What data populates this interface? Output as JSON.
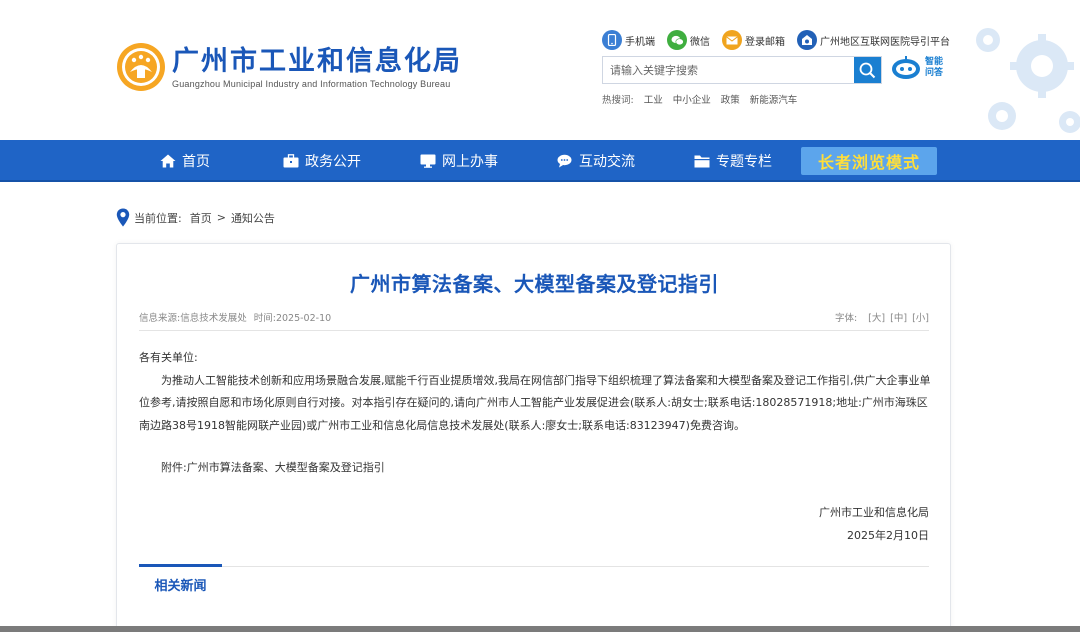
{
  "header": {
    "logo_cn": "广州市工业和信息化局",
    "logo_en": "Guangzhou Municipal Industry and Information Technology Bureau",
    "quick_links": [
      {
        "label": "手机端",
        "icon": "mobile-icon",
        "color": "#3b7fd4"
      },
      {
        "label": "微信",
        "icon": "wechat-icon",
        "color": "#3fae3f"
      },
      {
        "label": "登录邮箱",
        "icon": "mail-icon",
        "color": "#f0a41e"
      },
      {
        "label": "广州地区互联网医院导引平台",
        "icon": "hospital-icon",
        "color": "#2261b7"
      }
    ],
    "search_placeholder": "请输入关键字搜索",
    "robot_label_1": "智能",
    "robot_label_2": "问答",
    "hot_label": "热搜词:",
    "hot_words": [
      "工业",
      "中小企业",
      "政策",
      "新能源汽车"
    ]
  },
  "nav": {
    "items": [
      {
        "label": "首页",
        "icon": "home-icon"
      },
      {
        "label": "政务公开",
        "icon": "briefcase-icon"
      },
      {
        "label": "网上办事",
        "icon": "monitor-icon"
      },
      {
        "label": "互动交流",
        "icon": "chat-icon"
      },
      {
        "label": "专题专栏",
        "icon": "folder-icon"
      }
    ],
    "elder_mode": "长者浏览模式"
  },
  "breadcrumb": {
    "label": "当前位置:",
    "home": "首页",
    "separator": ">",
    "current": "通知公告"
  },
  "article": {
    "title": "广州市算法备案、大模型备案及登记指引",
    "source_label": "信息来源:",
    "source": "信息技术发展处",
    "time_label": "时间:",
    "time": "2025-02-10",
    "font_label": "字体:",
    "font_large": "[大]",
    "font_medium": "[中]",
    "font_small": "[小]",
    "salutation": "各有关单位:",
    "body": "为推动人工智能技术创新和应用场景融合发展,赋能千行百业提质增效,我局在网信部门指导下组织梳理了算法备案和大模型备案及登记工作指引,供广大企事业单位参考,请按照自愿和市场化原则自行对接。对本指引存在疑问的,请向广州市人工智能产业发展促进会(联系人:胡女士;联系电话:18028571918;地址:广州市海珠区南边路38号1918智能网联产业园)或广州市工业和信息化局信息技术发展处(联系人:廖女士;联系电话:83123947)免费咨询。",
    "attachment_label": "附件:",
    "attachment": "广州市算法备案、大模型备案及登记指引",
    "signature_org": "广州市工业和信息化局",
    "signature_date": "2025年2月10日",
    "related_title": "相关新闻"
  },
  "colors": {
    "brand_blue": "#1a57b8",
    "nav_blue": "#1f64c6",
    "elder_text": "#ffde3a"
  }
}
